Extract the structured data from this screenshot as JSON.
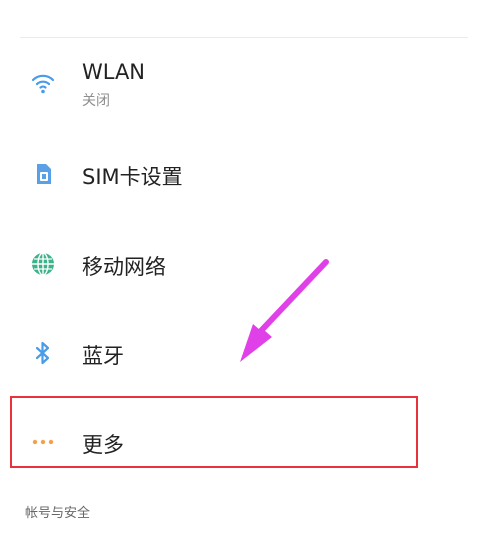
{
  "settings": {
    "wlan": {
      "label": "WLAN",
      "status": "关闭",
      "icon": "wifi-icon"
    },
    "sim": {
      "label": "SIM卡设置",
      "icon": "sim-card-icon"
    },
    "mobile_network": {
      "label": "移动网络",
      "icon": "globe-icon"
    },
    "bluetooth": {
      "label": "蓝牙",
      "icon": "bluetooth-icon"
    },
    "more": {
      "label": "更多",
      "icon": "more-dots-icon"
    }
  },
  "section_header": "帐号与安全",
  "colors": {
    "wifi": "#4a9be8",
    "sim": "#5aa0e6",
    "globe": "#3cb38a",
    "bluetooth": "#4a9be8",
    "more": "#f5a04a",
    "highlight": "#e8333c",
    "arrow": "#e040e8"
  }
}
